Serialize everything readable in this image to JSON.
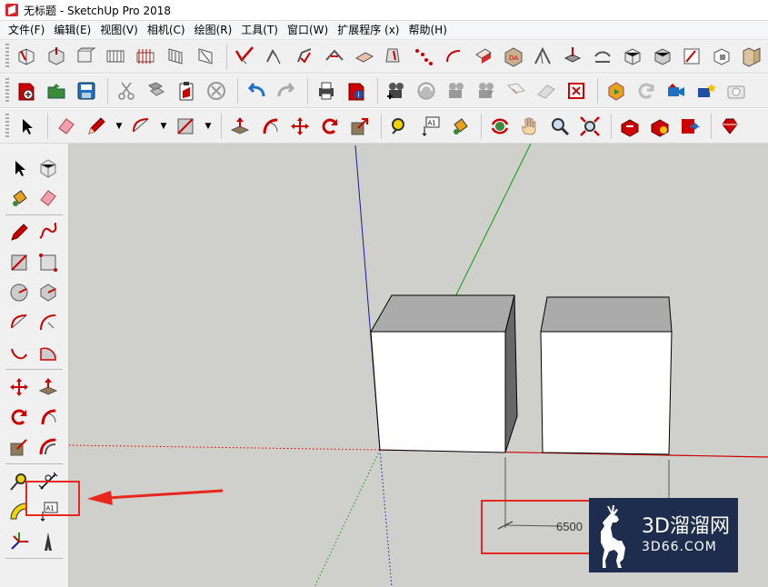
{
  "window": {
    "title": "无标题 - SketchUp Pro 2018"
  },
  "menu": {
    "items": [
      "文件(F)",
      "编辑(E)",
      "视图(V)",
      "相机(C)",
      "绘图(R)",
      "工具(T)",
      "窗口(W)",
      "扩展程序 (x)",
      "帮助(H)"
    ]
  },
  "viewport": {
    "dimension_text": "6500",
    "colors": {
      "background": "#cfcfcb",
      "axis_red": "#cc0000",
      "axis_green": "#119911",
      "axis_blue": "#1a1aa0",
      "highlight": "#e8281e"
    }
  },
  "left_toolbar": {
    "highlighted_tool": "dimension-icon"
  },
  "watermark": {
    "main": "3D溜溜网",
    "sub": "3D66.COM"
  }
}
